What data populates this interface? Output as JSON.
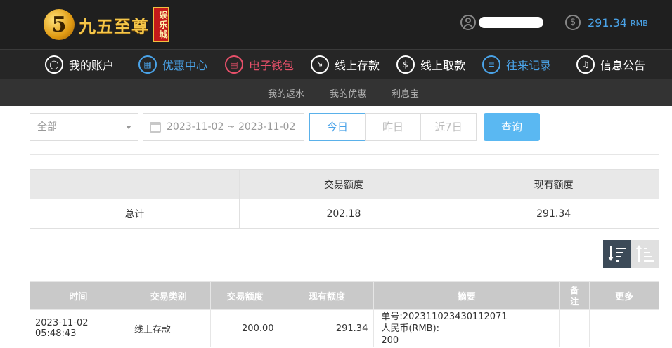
{
  "header": {
    "logo_digit": "5",
    "logo_text": "九五至尊",
    "logo_sub": "娱乐城",
    "balance": "291.34",
    "currency": "RMB",
    "balance_icon": "$"
  },
  "nav": {
    "items": [
      {
        "label": "我的账户",
        "icon": "user-icon",
        "icon_glyph": "◯",
        "color": "#ffffff"
      },
      {
        "label": "优惠中心",
        "icon": "gift-icon",
        "icon_glyph": "▦",
        "color": "#4aa3e8"
      },
      {
        "label": "电子钱包",
        "icon": "wallet-icon",
        "icon_glyph": "▤",
        "color": "#e8506a"
      },
      {
        "label": "线上存款",
        "icon": "deposit-icon",
        "icon_glyph": "⇲",
        "color": "#ffffff"
      },
      {
        "label": "线上取款",
        "icon": "withdraw-icon",
        "icon_glyph": "$",
        "color": "#ffffff"
      },
      {
        "label": "往来记录",
        "icon": "records-icon",
        "icon_glyph": "≡",
        "color": "#4aa3e8"
      },
      {
        "label": "信息公告",
        "icon": "bell-icon",
        "icon_glyph": "♫",
        "color": "#ffffff"
      }
    ]
  },
  "subnav": {
    "items": [
      "我的返水",
      "我的优惠",
      "利息宝"
    ]
  },
  "filters": {
    "type_value": "全部",
    "date_range": "2023-11-02 ~ 2023-11-02",
    "quick_ranges": [
      "今日",
      "昨日",
      "近7日"
    ],
    "active_range": "今日",
    "query_label": "查询"
  },
  "summary": {
    "headers": [
      "",
      "交易额度",
      "现有额度"
    ],
    "row": {
      "label": "总计",
      "amount": "202.18",
      "balance": "291.34"
    }
  },
  "records": {
    "headers": [
      "时间",
      "交易类别",
      "交易额度",
      "现有额度",
      "摘要",
      "备注",
      "更多"
    ],
    "rows": [
      {
        "time": "2023-11-02 05:48:43",
        "type": "线上存款",
        "amount": "200.00",
        "balance": "291.34",
        "summary_line1": "单号:202311023430112071",
        "summary_line2": "人民币(RMB):",
        "summary_line3": "200",
        "note": "",
        "more": ""
      }
    ]
  }
}
